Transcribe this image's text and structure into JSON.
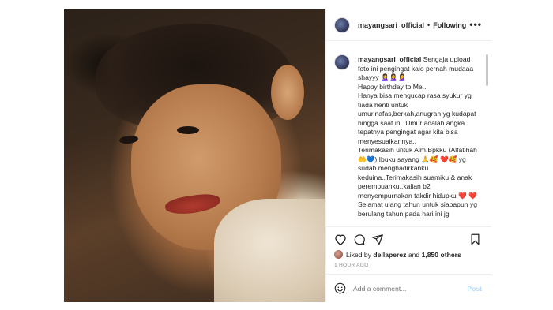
{
  "header": {
    "username": "mayangsari_official",
    "separator": "•",
    "follow_status": "Following",
    "more_glyph": "•••"
  },
  "caption": {
    "username": "mayangsari_official",
    "lines": [
      "Sengaja upload foto ini pengingat kalo pernah mudaaa shayyy 🙎‍♀️🙎‍♀️🙎‍♀️",
      "Happy birthday to Me..",
      "Hanya bisa mengucap rasa syukur yg tiada henti untuk umur,nafas,berkah,anugrah yg kudapat hingga saat ini..Umur adalah angka tepatnya pengingat agar kita bisa menyesuaikannya..",
      "Terimakasih untuk Alm.Bpkku (Alfatihah 🤲💙) Ibuku sayang 🙏🥰 ❤️🥰 yg sudah menghadirkanku keduina..Terimakasih suamiku & anak perempuanku..kalian b2 menyempurnakan takdir hidupku ❤️ ❤️",
      "Selamat ulang tahun untuk siapapun yg berulang tahun pada hari ini jg"
    ]
  },
  "icons": {
    "like": "heart-icon",
    "comment": "comment-icon",
    "share": "share-icon",
    "save": "bookmark-icon",
    "emoji": "emoji-icon"
  },
  "likes": {
    "prefix": "Liked by",
    "user": "dellaperez",
    "conjunction": "and",
    "count_text": "1,850 others"
  },
  "timestamp": "1 HOUR AGO",
  "comment": {
    "placeholder": "Add a comment...",
    "post_label": "Post"
  }
}
